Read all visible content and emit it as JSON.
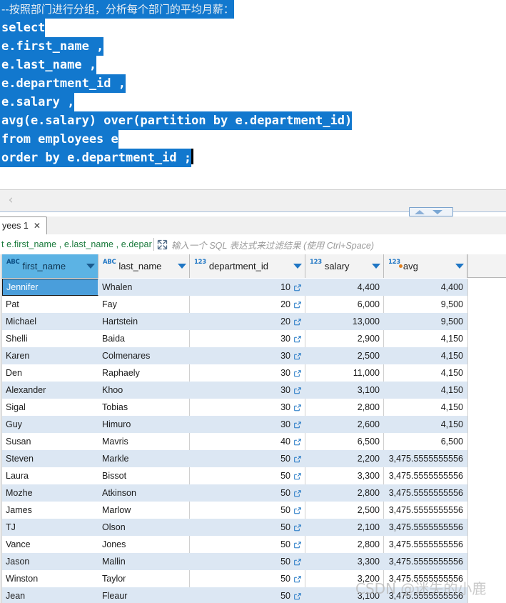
{
  "editor": {
    "lines": [
      {
        "text": "--按照部门进行分组，分析每个部门的平均月薪：",
        "kind": "comment"
      },
      {
        "text": "select",
        "kind": "sql"
      },
      {
        "text": "e.first_name ,",
        "kind": "sql"
      },
      {
        "text": "e.last_name ,",
        "kind": "sql"
      },
      {
        "text": "e.department_id ,",
        "kind": "sql"
      },
      {
        "text": "e.salary ,",
        "kind": "sql"
      },
      {
        "text": "avg(e.salary) over(partition by e.department_id)",
        "kind": "sql"
      },
      {
        "text": "from employees e",
        "kind": "sql"
      },
      {
        "text": "order by e.department_id ;",
        "kind": "sql"
      }
    ],
    "selection_color": "#1278ce"
  },
  "toolbar": {
    "back_label": "‹",
    "back_icon": "chevron-left-icon"
  },
  "splitter": {
    "up_icon": "caret-up-icon",
    "down_icon": "caret-down-icon"
  },
  "result_tab": {
    "label": "yees 1",
    "close_label": "✕"
  },
  "filter_bar": {
    "sql_text": "t e.first_name , e.last_name , e.depar",
    "expand_icon": "expand-arrows-icon",
    "placeholder": "输入一个 SQL 表达式来过滤结果 (使用 Ctrl+Space)"
  },
  "grid": {
    "columns": [
      {
        "name": "first_name",
        "type_icon": "ABC",
        "type": "text",
        "width": 135,
        "selected": true,
        "computed": false
      },
      {
        "name": "last_name",
        "type_icon": "ABC",
        "type": "text",
        "width": 128,
        "selected": false,
        "computed": false
      },
      {
        "name": "department_id",
        "type_icon": "123",
        "type": "numeric",
        "width": 162,
        "selected": false,
        "computed": false
      },
      {
        "name": "salary",
        "type_icon": "123",
        "type": "numeric",
        "width": 110,
        "selected": false,
        "computed": false
      },
      {
        "name": "avg",
        "type_icon": "123",
        "type": "numeric",
        "width": 117,
        "selected": false,
        "computed": true
      }
    ],
    "link_icon": "external-link-icon",
    "selected_cell": {
      "row": 0,
      "column": 0
    },
    "rows": [
      {
        "first_name": "Jennifer",
        "last_name": "Whalen",
        "department_id": "10",
        "salary": "4,400",
        "avg": "4,400"
      },
      {
        "first_name": "Pat",
        "last_name": "Fay",
        "department_id": "20",
        "salary": "6,000",
        "avg": "9,500"
      },
      {
        "first_name": "Michael",
        "last_name": "Hartstein",
        "department_id": "20",
        "salary": "13,000",
        "avg": "9,500"
      },
      {
        "first_name": "Shelli",
        "last_name": "Baida",
        "department_id": "30",
        "salary": "2,900",
        "avg": "4,150"
      },
      {
        "first_name": "Karen",
        "last_name": "Colmenares",
        "department_id": "30",
        "salary": "2,500",
        "avg": "4,150"
      },
      {
        "first_name": "Den",
        "last_name": "Raphaely",
        "department_id": "30",
        "salary": "11,000",
        "avg": "4,150"
      },
      {
        "first_name": "Alexander",
        "last_name": "Khoo",
        "department_id": "30",
        "salary": "3,100",
        "avg": "4,150"
      },
      {
        "first_name": "Sigal",
        "last_name": "Tobias",
        "department_id": "30",
        "salary": "2,800",
        "avg": "4,150"
      },
      {
        "first_name": "Guy",
        "last_name": "Himuro",
        "department_id": "30",
        "salary": "2,600",
        "avg": "4,150"
      },
      {
        "first_name": "Susan",
        "last_name": "Mavris",
        "department_id": "40",
        "salary": "6,500",
        "avg": "6,500"
      },
      {
        "first_name": "Steven",
        "last_name": "Markle",
        "department_id": "50",
        "salary": "2,200",
        "avg": "3,475.5555555556"
      },
      {
        "first_name": "Laura",
        "last_name": "Bissot",
        "department_id": "50",
        "salary": "3,300",
        "avg": "3,475.5555555556"
      },
      {
        "first_name": "Mozhe",
        "last_name": "Atkinson",
        "department_id": "50",
        "salary": "2,800",
        "avg": "3,475.5555555556"
      },
      {
        "first_name": "James",
        "last_name": "Marlow",
        "department_id": "50",
        "salary": "2,500",
        "avg": "3,475.5555555556"
      },
      {
        "first_name": "TJ",
        "last_name": "Olson",
        "department_id": "50",
        "salary": "2,100",
        "avg": "3,475.5555555556"
      },
      {
        "first_name": "Vance",
        "last_name": "Jones",
        "department_id": "50",
        "salary": "2,800",
        "avg": "3,475.5555555556"
      },
      {
        "first_name": "Jason",
        "last_name": "Mallin",
        "department_id": "50",
        "salary": "3,300",
        "avg": "3,475.5555555556"
      },
      {
        "first_name": "Winston",
        "last_name": "Taylor",
        "department_id": "50",
        "salary": "3,200",
        "avg": "3,475.5555555556"
      },
      {
        "first_name": "Jean",
        "last_name": "Fleaur",
        "department_id": "50",
        "salary": "3,100",
        "avg": "3,475.5555555556"
      }
    ]
  },
  "watermark": {
    "text": "CSDN @迷失的小鹿"
  },
  "colors": {
    "editor_selection": "#1278ce",
    "header_selected": "#5cb3e4",
    "row_alt": "#dce7f3",
    "accent_blue": "#1f76c4",
    "computed_dot": "#e08020",
    "filter_sql_green": "#1a7a3c"
  }
}
